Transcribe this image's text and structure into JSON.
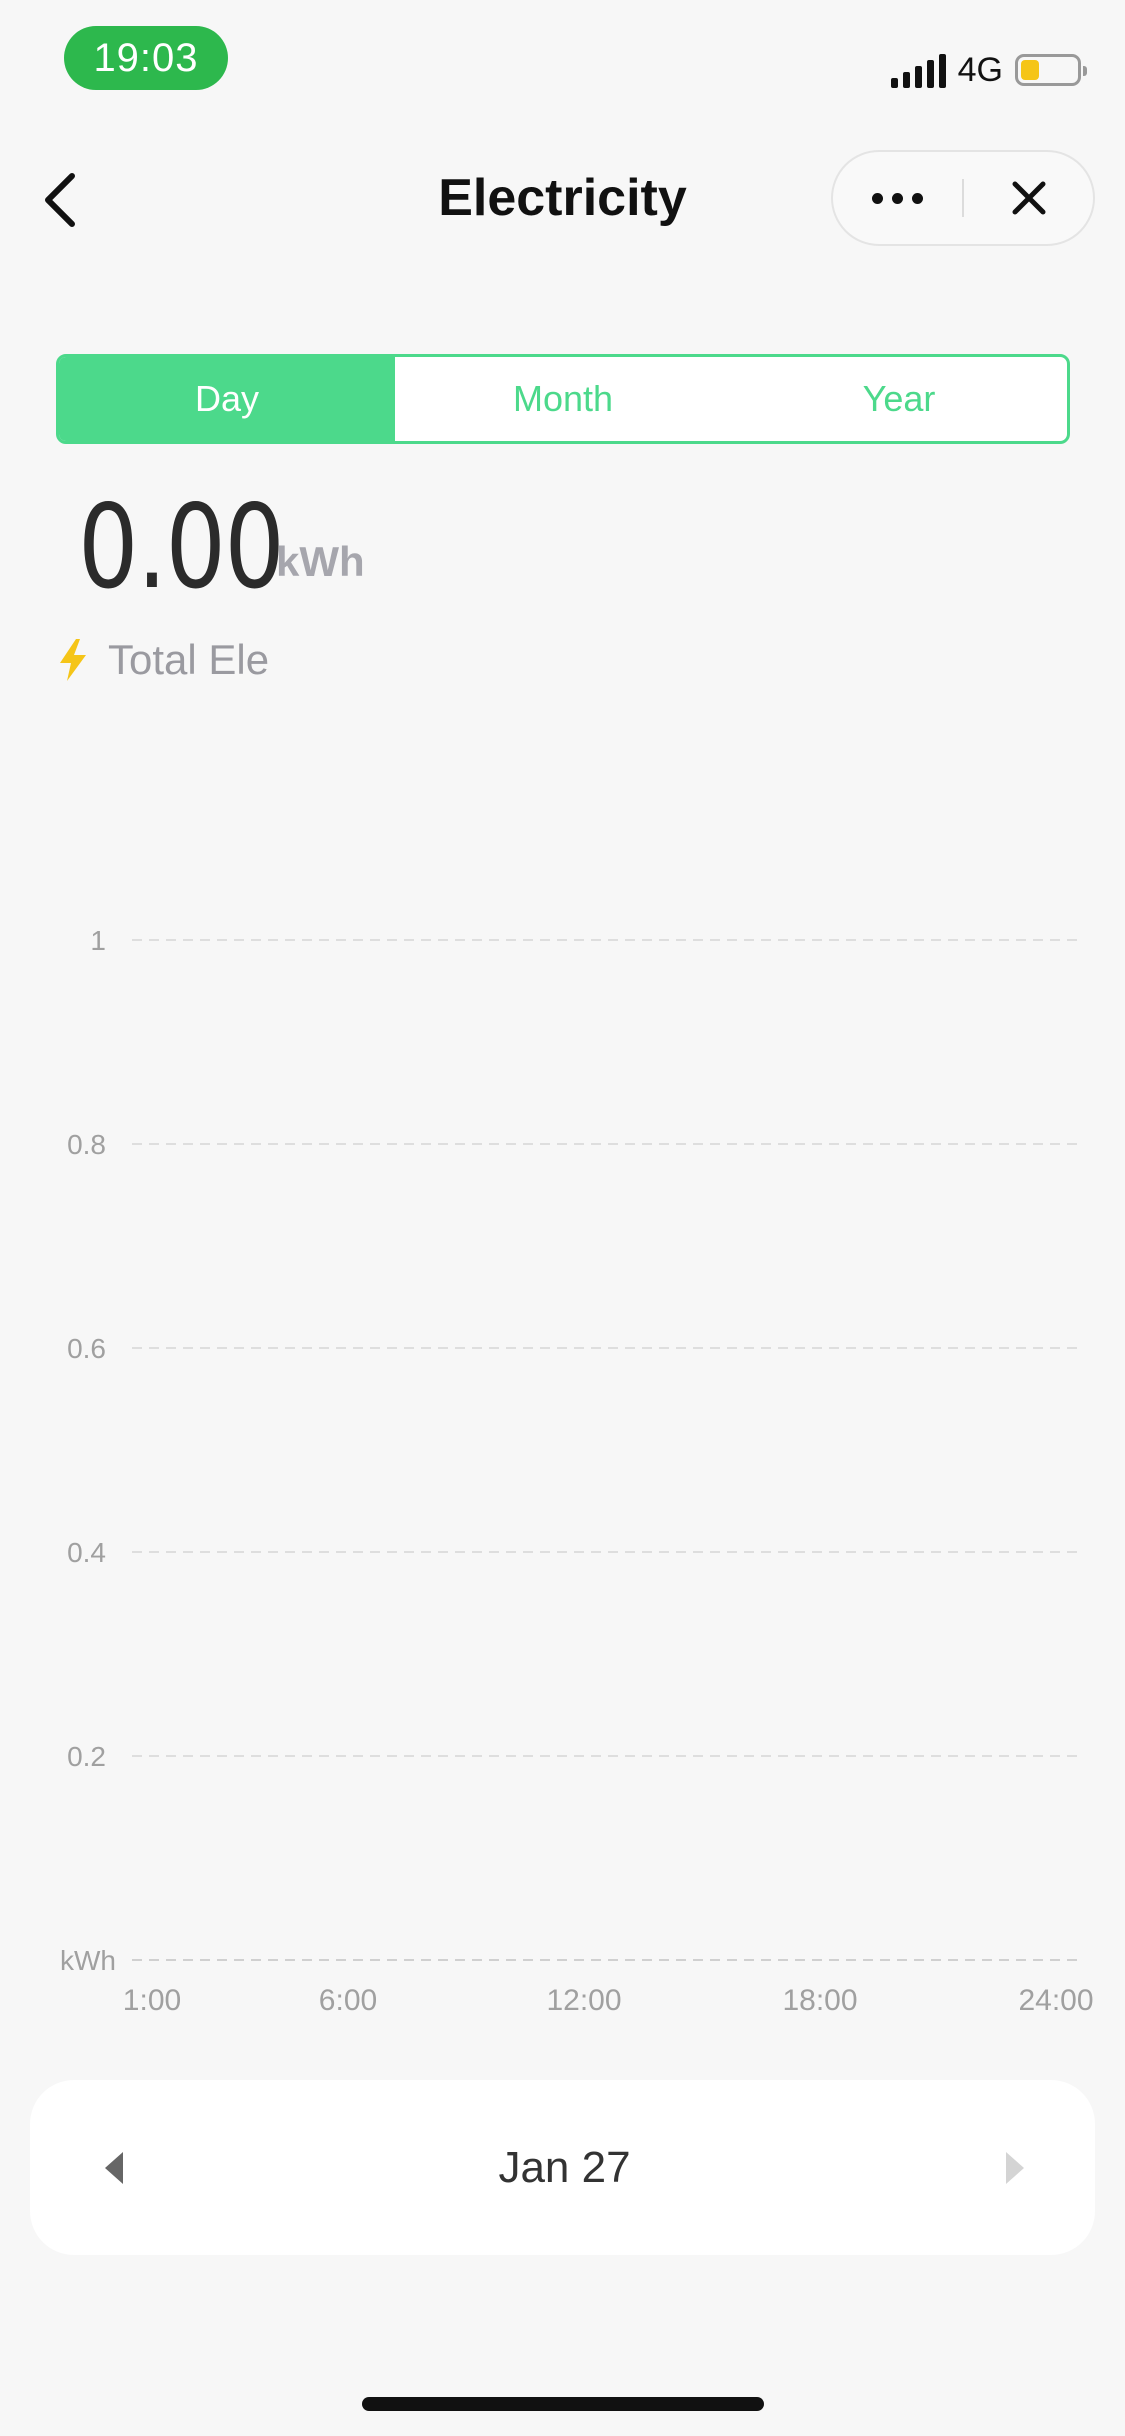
{
  "status_bar": {
    "time": "19:03",
    "network": "4G",
    "battery_level": 0.2,
    "time_badge_color": "#2db84d"
  },
  "nav": {
    "title": "Electricity",
    "back_icon": "chevron-left-icon",
    "more_icon": "more-horizontal-icon",
    "close_icon": "close-icon"
  },
  "tabs": [
    {
      "label": "Day",
      "active": true
    },
    {
      "label": "Month",
      "active": false
    },
    {
      "label": "Year",
      "active": false
    }
  ],
  "accent_color": "#4cd98b",
  "total": {
    "value": "0.00",
    "unit": "kWh",
    "label": "Total Ele",
    "icon": "lightning-icon"
  },
  "chart_data": {
    "type": "bar",
    "ylabel": "kWh",
    "yticks": [
      "1",
      "0.8",
      "0.6",
      "0.4",
      "0.2"
    ],
    "ylim": [
      0,
      1
    ],
    "xticks": [
      "1:00",
      "6:00",
      "12:00",
      "18:00",
      "24:00"
    ],
    "grid": true,
    "series": [
      {
        "values": []
      }
    ]
  },
  "date_picker": {
    "label": "Jan 27",
    "prev_icon": "caret-left-icon",
    "next_icon": "caret-right-icon"
  }
}
